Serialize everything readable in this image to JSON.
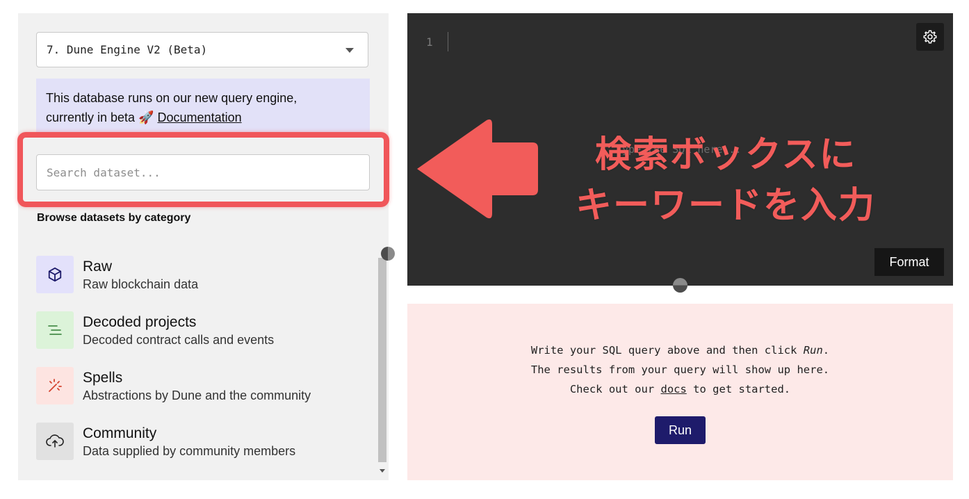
{
  "left_panel": {
    "database_select": {
      "value": "7. Dune Engine V2 (Beta)"
    },
    "beta_notice": {
      "text_line1": "This database runs on our new query engine,",
      "text_line2": "currently in beta",
      "emoji": "🚀",
      "link": "Documentation"
    },
    "search": {
      "placeholder": "Search dataset..."
    },
    "category_heading": "Browse datasets by category",
    "categories": [
      {
        "title": "Raw",
        "desc": "Raw blockchain data",
        "icon": "cube-icon",
        "bg": "#e3e1fb"
      },
      {
        "title": "Decoded projects",
        "desc": "Decoded contract calls and events",
        "icon": "lines-icon",
        "bg": "#dcf3d9"
      },
      {
        "title": "Spells",
        "desc": "Abstractions by Dune and the community",
        "icon": "magic-wand-icon",
        "bg": "#fde4e1"
      },
      {
        "title": "Community",
        "desc": "Data supplied by community members",
        "icon": "cloud-upload-icon",
        "bg": "#e1e1e1"
      }
    ]
  },
  "editor": {
    "line_number": "1",
    "placeholder": "Type the SQL here...",
    "format_label": "Format"
  },
  "results": {
    "line1_prefix": "Write your SQL query above and then click ",
    "line1_em": "Run",
    "line1_suffix": ".",
    "line2": "The results from your query will show up here.",
    "line3_prefix": "Check out our ",
    "line3_link": "docs",
    "line3_suffix": " to get started.",
    "run_label": "Run"
  },
  "annotation": {
    "line1": "検索ボックスに",
    "line2": "キーワードを入力",
    "color": "#f25c5a"
  }
}
